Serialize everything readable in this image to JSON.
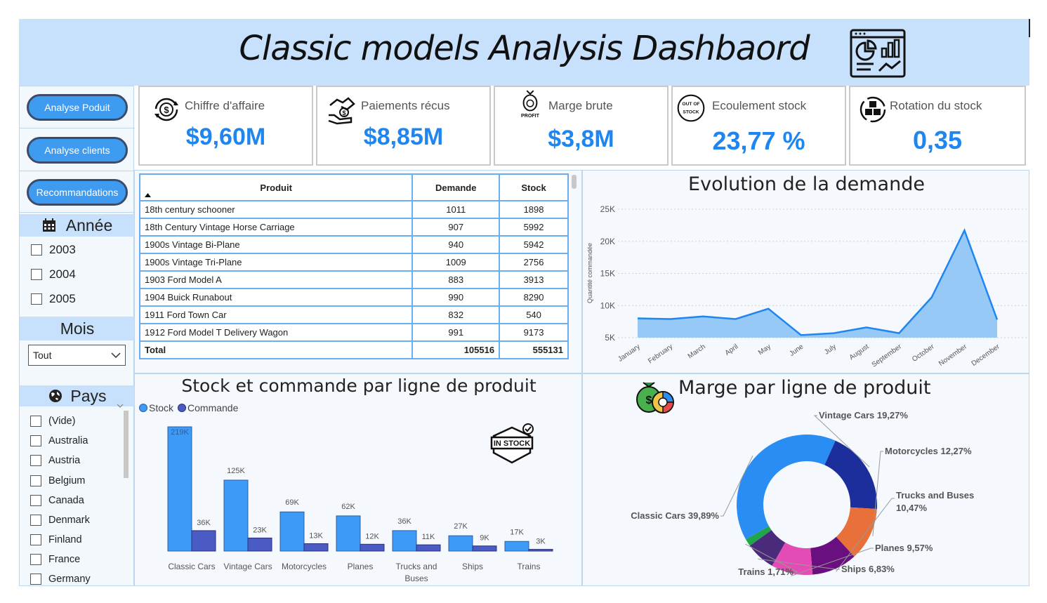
{
  "header": {
    "title": "Classic models Analysis Dashbaord",
    "logo_icon": "analytics-dashboard-icon"
  },
  "nav": {
    "analyse_produit": "Analyse Poduit",
    "analyse_clients": "Analyse clients",
    "recommandations": "Recommandations"
  },
  "annee": {
    "label": "Année",
    "icon": "calendar-icon",
    "options": [
      "2003",
      "2004",
      "2005"
    ]
  },
  "mois": {
    "label": "Mois",
    "selected": "Tout"
  },
  "pays": {
    "label": "Pays",
    "icon": "globe-icon",
    "options": [
      "(Vide)",
      "Australia",
      "Austria",
      "Belgium",
      "Canada",
      "Denmark",
      "Finland",
      "France",
      "Germany"
    ]
  },
  "kpis": [
    {
      "label": "Chiffre d'affaire",
      "value": "$9,60M",
      "icon": "dollar-cycle-icon"
    },
    {
      "label": "Paiements récus",
      "value": "$8,85M",
      "icon": "payment-hand-icon"
    },
    {
      "label": "Marge brute",
      "value": "$3,8M",
      "icon": "profit-bag-icon",
      "icon_text": "PROFIT"
    },
    {
      "label": "Ecoulement stock",
      "value": "23,77 %",
      "icon": "out-of-stock-icon",
      "icon_text": "OUT OF STOCK"
    },
    {
      "label": "Rotation du stock",
      "value": "0,35",
      "icon": "stock-rotation-icon"
    }
  ],
  "table": {
    "headers": [
      "Produit",
      "Demande",
      "Stock"
    ],
    "rows": [
      [
        "18th century schooner",
        "1011",
        "1898"
      ],
      [
        "18th Century Vintage Horse Carriage",
        "907",
        "5992"
      ],
      [
        "1900s Vintage Bi-Plane",
        "940",
        "5942"
      ],
      [
        "1900s Vintage Tri-Plane",
        "1009",
        "2756"
      ],
      [
        "1903 Ford Model A",
        "883",
        "3913"
      ],
      [
        "1904 Buick Runabout",
        "990",
        "8290"
      ],
      [
        "1911 Ford Town Car",
        "832",
        "540"
      ],
      [
        "1912 Ford Model T Delivery Wagon",
        "991",
        "9173"
      ]
    ],
    "total": [
      "Total",
      "105516",
      "555131"
    ]
  },
  "colors": {
    "accent": "#1f86f0",
    "header_bg": "#c7e0fb",
    "stock": "#3d9bf7",
    "commande": "#4a5cc4"
  },
  "chart_data": [
    {
      "type": "area",
      "title": "Evolution de la demande",
      "ylabel": "Quantité commandée",
      "xlabel": "",
      "categories": [
        "January",
        "February",
        "March",
        "April",
        "May",
        "June",
        "July",
        "August",
        "September",
        "October",
        "November",
        "December"
      ],
      "values": [
        8000,
        7900,
        8300,
        7900,
        9500,
        5400,
        5700,
        6600,
        5700,
        11300,
        21700,
        7800
      ],
      "ylim": [
        5000,
        25000
      ],
      "yticks": [
        "5K",
        "10K",
        "15K",
        "20K",
        "25K"
      ],
      "ytick_values": [
        5000,
        10000,
        15000,
        20000,
        25000
      ],
      "grid": true
    },
    {
      "type": "bar",
      "title": "Stock et commande par ligne de produit",
      "categories": [
        "Classic Cars",
        "Vintage Cars",
        "Motorcycles",
        "Planes",
        "Trucks and Buses",
        "Ships",
        "Trains"
      ],
      "series": [
        {
          "name": "Stock",
          "values": [
            219000,
            125000,
            69000,
            62000,
            36000,
            27000,
            17000
          ],
          "labels": [
            "219K",
            "125K",
            "69K",
            "62K",
            "36K",
            "27K",
            "17K"
          ]
        },
        {
          "name": "Commande",
          "values": [
            36000,
            23000,
            13000,
            12000,
            11000,
            9000,
            3000
          ],
          "labels": [
            "36K",
            "23K",
            "13K",
            "12K",
            "11K",
            "9K",
            "3K"
          ]
        }
      ],
      "legend": "top-left",
      "badge": "IN STOCK"
    },
    {
      "type": "pie",
      "title": "Marge par ligne de produit",
      "slices": [
        {
          "label": "Classic Cars 39,89%",
          "value": 39.89,
          "color": "#2a8df3"
        },
        {
          "label": "Vintage Cars 19,27%",
          "value": 19.27,
          "color": "#1b2e9c"
        },
        {
          "label": "Motorcycles 12,27%",
          "value": 12.27,
          "color": "#e8703a"
        },
        {
          "label": "Trucks and Buses 10,47%",
          "value": 10.47,
          "color": "#6a0f7f"
        },
        {
          "label": "Planes 9,57%",
          "value": 9.57,
          "color": "#e34bb5"
        },
        {
          "label": "Ships 6,83%",
          "value": 6.83,
          "color": "#4a2a7a"
        },
        {
          "label": "Trains 1,71%",
          "value": 1.71,
          "color": "#20a64a"
        }
      ]
    }
  ]
}
